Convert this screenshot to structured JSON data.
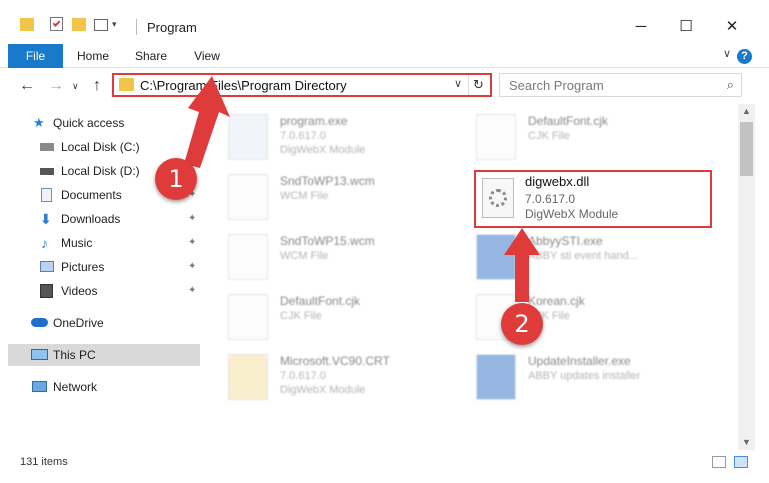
{
  "window": {
    "title": "Program",
    "minimize_icon": "─",
    "maximize_icon": "☐",
    "close_icon": "✕"
  },
  "ribbon": {
    "tabs": [
      "File",
      "Home",
      "Share",
      "View"
    ],
    "help_icon": "?",
    "collapse_icon": "∨"
  },
  "nav": {
    "back_icon": "←",
    "forward_icon": "→",
    "recent_icon": "∨",
    "up_icon": "↑",
    "address": "C:\\Program Files\\Program Directory",
    "dropdown_icon": "∨",
    "refresh_icon": "↻",
    "search_placeholder": "Search Program",
    "search_icon": "⌕"
  },
  "sidebar": {
    "items": [
      {
        "label": "Quick access"
      },
      {
        "label": "Local Disk (C:)",
        "pinned": true
      },
      {
        "label": "Local Disk (D:)",
        "pinned": true
      },
      {
        "label": "Documents",
        "pinned": true
      },
      {
        "label": "Downloads",
        "pinned": true
      },
      {
        "label": "Music",
        "pinned": true
      },
      {
        "label": "Pictures",
        "pinned": true
      },
      {
        "label": "Videos",
        "pinned": true
      },
      {
        "label": "OneDrive"
      },
      {
        "label": "This PC",
        "selected": true
      },
      {
        "label": "Network"
      }
    ],
    "pin_icon": "📌"
  },
  "files": {
    "col1": [
      {
        "name": "program.exe",
        "line2": "7.0.617.0",
        "line3": "DigWebX Module"
      },
      {
        "name": "SndToWP13.wcm",
        "line2": "WCM File",
        "line3": ""
      },
      {
        "name": "SndToWP15.wcm",
        "line2": "WCM File",
        "line3": ""
      },
      {
        "name": "DefaultFont.cjk",
        "line2": "CJK File",
        "line3": ""
      },
      {
        "name": "Microsoft.VC90.CRT",
        "line2": "7.0.617.0",
        "line3": "DigWebX Module"
      }
    ],
    "col2": [
      {
        "name": "DefaultFont.cjk",
        "line2": "CJK File",
        "line3": ""
      },
      {
        "name": "AbbyySTI.exe",
        "line2": "ABBY sti event hand...",
        "line3": ""
      },
      {
        "name": "Korean.cjk",
        "line2": "CJK File",
        "line3": ""
      },
      {
        "name": "UpdateInstaller.exe",
        "line2": "ABBY updates installer",
        "line3": ""
      }
    ],
    "highlighted": {
      "name": "digwebx.dll",
      "line2": "7.0.617.0",
      "line3": "DigWebX Module"
    }
  },
  "status": {
    "items_count": "131 items"
  },
  "annotations": {
    "step1": "1",
    "step2": "2",
    "color": "#e03b3b"
  }
}
